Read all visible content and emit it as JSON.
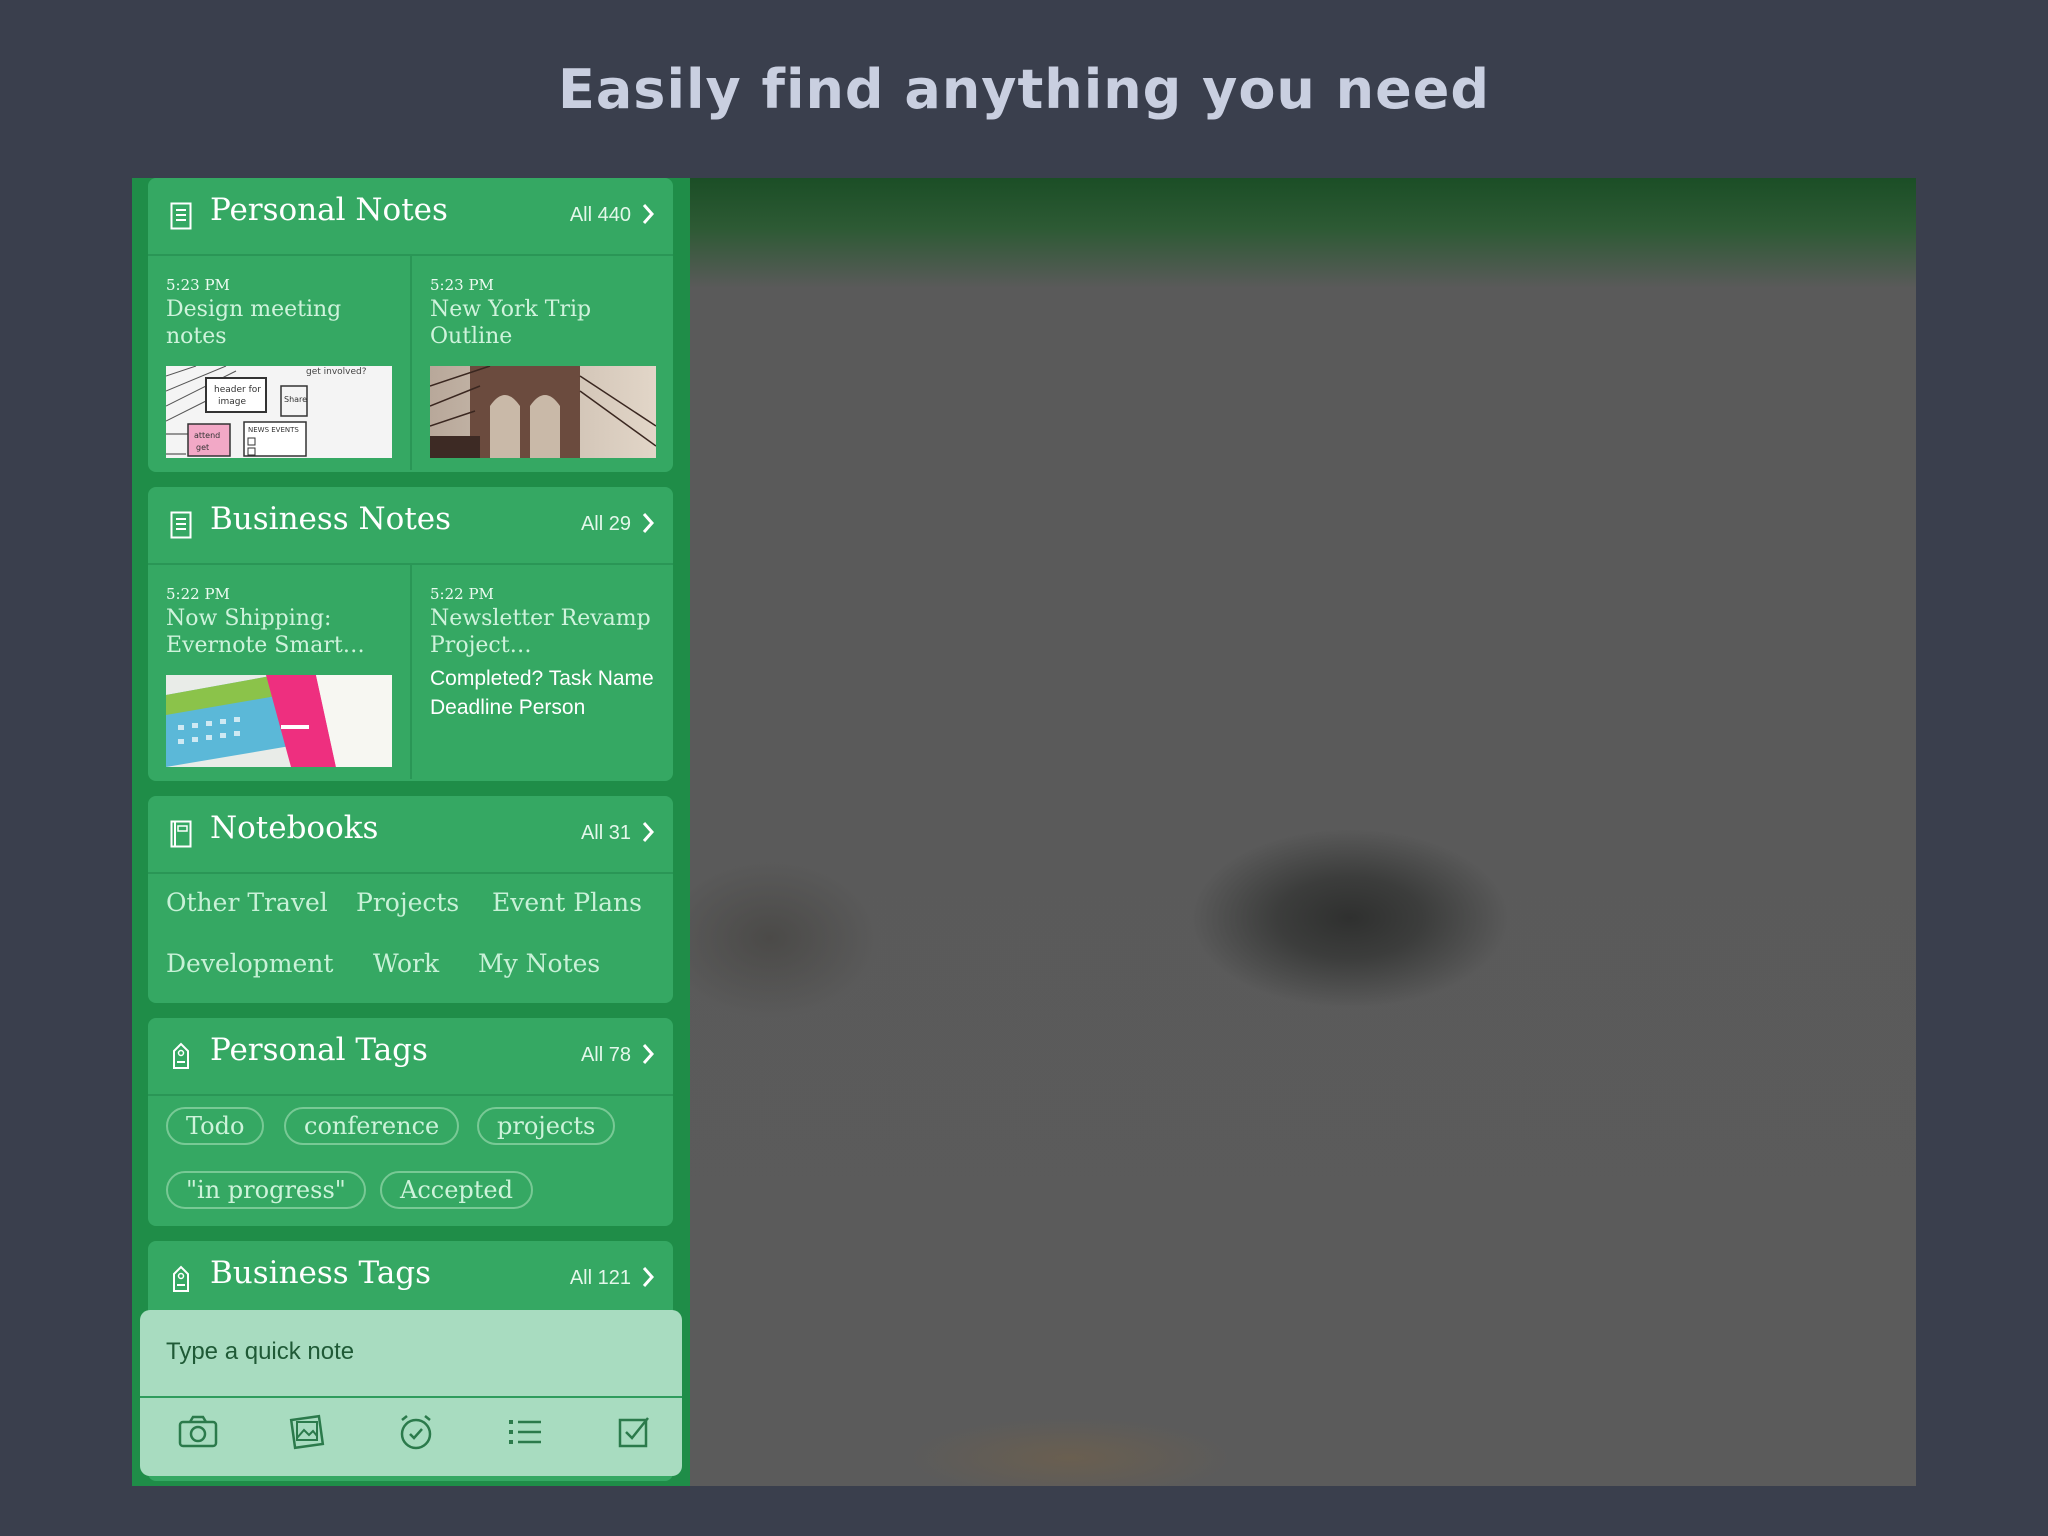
{
  "headline": "Easily find anything you need",
  "personal_notes": {
    "title": "Personal Notes",
    "all": "All 440",
    "notes": [
      {
        "time": "5:23 PM",
        "title": "Design meeting notes"
      },
      {
        "time": "5:23 PM",
        "title": "New York Trip Outline"
      }
    ]
  },
  "business_notes": {
    "title": "Business Notes",
    "all": "All 29",
    "notes": [
      {
        "time": "5:22 PM",
        "title": "Now Shipping: Evernote Smart…"
      },
      {
        "time": "5:22 PM",
        "title": "Newsletter Revamp Project…",
        "body": "Completed? Task Name Deadline Person"
      }
    ]
  },
  "notebooks": {
    "title": "Notebooks",
    "all": "All 31",
    "items": [
      "Other Travel",
      "Projects",
      "Event Plans",
      "Development",
      "Work",
      "My Notes"
    ]
  },
  "personal_tags": {
    "title": "Personal Tags",
    "all": "All 78",
    "items": [
      "Todo",
      "conference",
      "projects",
      "\"in progress\"",
      "Accepted"
    ]
  },
  "business_tags": {
    "title": "Business Tags",
    "all": "All 121"
  },
  "quick_note": {
    "placeholder": "Type a quick note",
    "buttons": [
      "camera-icon",
      "photo-icon",
      "reminder-icon",
      "list-icon",
      "checkbox-icon"
    ]
  },
  "colors": {
    "background": "#3a3f4d",
    "sidebar": "#1f8d48",
    "card": "#35a863",
    "quick_note": "#a8dcc0"
  }
}
